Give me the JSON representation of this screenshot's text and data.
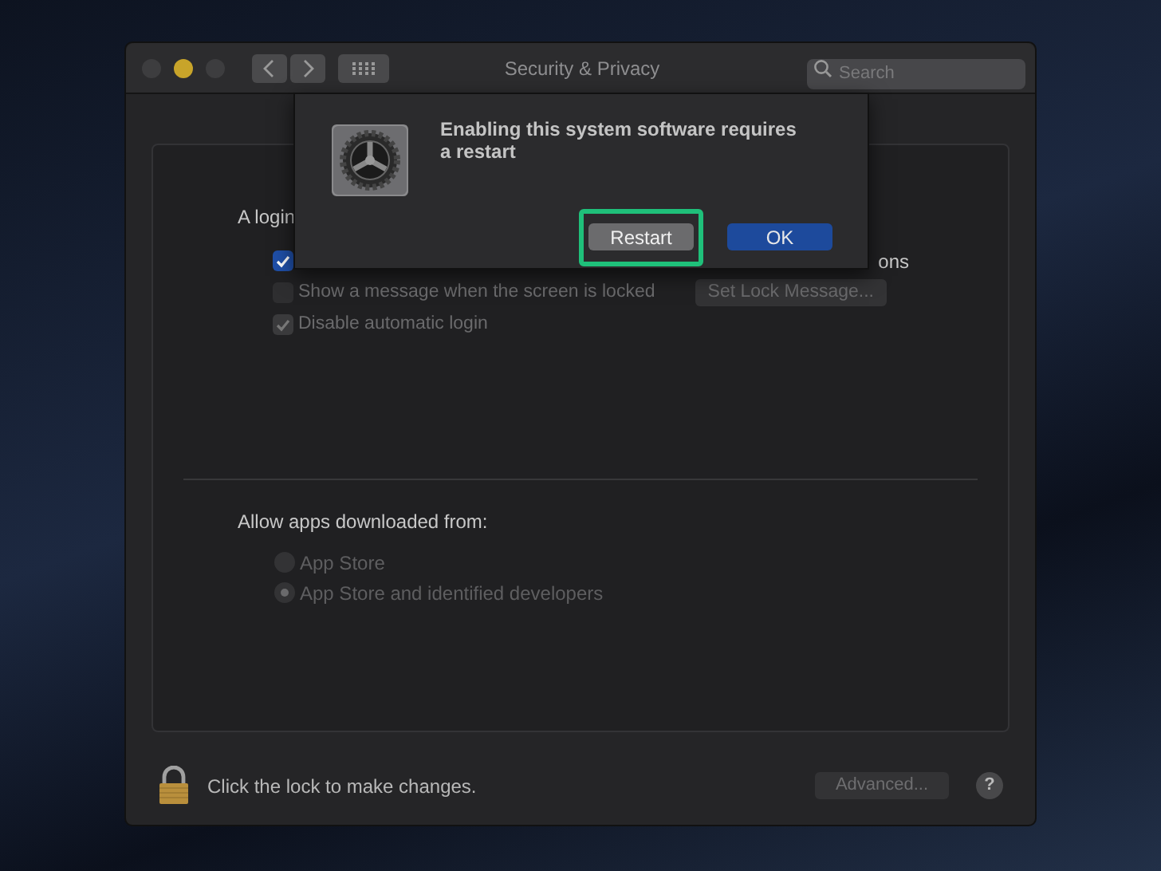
{
  "window": {
    "title": "Security & Privacy",
    "search": {
      "placeholder": "Search"
    },
    "traffic_lights": [
      {
        "color": "#3d3d3f"
      },
      {
        "color": "#c8a42a"
      },
      {
        "color": "#3d3d3f"
      }
    ]
  },
  "login_section": {
    "label": "A login",
    "options": [
      {
        "label": "ons",
        "checked": true,
        "disabled": false
      },
      {
        "label": "Show a message when the screen is locked",
        "checked": false,
        "disabled": true,
        "button": "Set Lock Message..."
      },
      {
        "label": "Disable automatic login",
        "checked": true,
        "disabled": true
      }
    ]
  },
  "downloads": {
    "label": "Allow apps downloaded from:",
    "options": [
      {
        "label": "App Store",
        "selected": false
      },
      {
        "label": "App Store and identified developers",
        "selected": true
      }
    ]
  },
  "footer": {
    "lock_text": "Click the lock to make changes.",
    "advanced_button": "Advanced...",
    "help": "?"
  },
  "dialog": {
    "message": "Enabling this system software requires a restart",
    "buttons": [
      {
        "label": "Restart",
        "kind": "secondary",
        "highlighted": true
      },
      {
        "label": "OK",
        "kind": "default",
        "highlighted": false
      }
    ]
  }
}
